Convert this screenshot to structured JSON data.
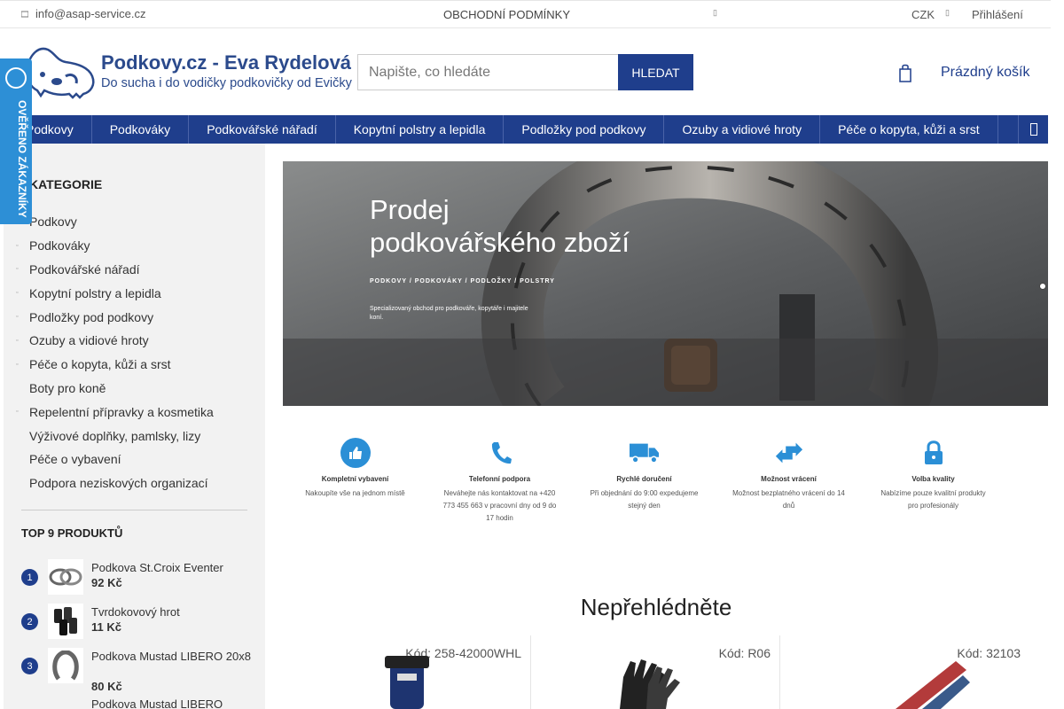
{
  "topbar": {
    "email": "info@asap-service.cz",
    "terms": "OBCHODNÍ PODMÍNKY",
    "currency": "CZK",
    "login": "Přihlášení"
  },
  "header": {
    "brand": "Podkovy.cz - Eva Rydelová",
    "tagline": "Do sucha i do vodičky podkovičky od Evičky",
    "search_placeholder": "Napište, co hledáte",
    "search_button": "HLEDAT",
    "cart_label": "Prázdný košík"
  },
  "badge": {
    "text": "OVĚŘENO ZÁKAZNÍKY"
  },
  "nav": [
    "Podkovy",
    "Podkováky",
    "Podkovářské nářadí",
    "Kopytní polstry a lepidla",
    "Podložky pod podkovy",
    "Ozuby a vidiové hroty",
    "Péče o kopyta, kůži a srst"
  ],
  "sidebar": {
    "title": "KATEGORIE",
    "categories": [
      {
        "label": "Podkovy",
        "bullet": true
      },
      {
        "label": "Podkováky",
        "bullet": true
      },
      {
        "label": "Podkovářské nářadí",
        "bullet": true
      },
      {
        "label": "Kopytní polstry a lepidla",
        "bullet": true
      },
      {
        "label": "Podložky pod podkovy",
        "bullet": true
      },
      {
        "label": "Ozuby a vidiové hroty",
        "bullet": true
      },
      {
        "label": "Péče o kopyta, kůži a srst",
        "bullet": true
      },
      {
        "label": "Boty pro koně",
        "bullet": false
      },
      {
        "label": "Repelentní přípravky a kosmetika",
        "bullet": true
      },
      {
        "label": "Výživové doplňky, pamlsky, lizy",
        "bullet": false
      },
      {
        "label": "Péče o vybavení",
        "bullet": false
      },
      {
        "label": "Podpora neziskových organizací",
        "bullet": false
      }
    ],
    "top_title": "TOP 9 PRODUKTŮ",
    "top_products": [
      {
        "rank": "1",
        "name": "Podkova St.Croix Eventer",
        "price": "92 Kč"
      },
      {
        "rank": "2",
        "name": "Tvrdokovový hrot",
        "price": "11 Kč"
      },
      {
        "rank": "3",
        "name": "Podkova Mustad LIBERO 20x8",
        "price": "80 Kč"
      },
      {
        "rank": "",
        "name": "Podkova Mustad LIBERO",
        "price": ""
      }
    ]
  },
  "banner": {
    "headline_1": "Prodej",
    "headline_2": "podkovářského zboží",
    "subline": "PODKOVY / PODKOVÁKY / PODLOŽKY / POLSTRY",
    "desc": "Specializovaný obchod pro podkováře, kopytáře i majitele koní."
  },
  "features": [
    {
      "title": "Kompletní vybavení",
      "desc": "Nakoupíte vše na jednom místě",
      "color": "#2b8fd6",
      "icon": "thumbs-up-icon"
    },
    {
      "title": "Telefonní podpora",
      "desc": "Neváhejte nás kontaktovat na +420 773 455 663 v pracovní dny od 9 do 17 hodin",
      "color": "#2b8fd6",
      "icon": "phone-icon"
    },
    {
      "title": "Rychlé doručení",
      "desc": "Při objednání do 9:00 expedujeme stejný den",
      "color": "#2b8fd6",
      "icon": "truck-icon"
    },
    {
      "title": "Možnost vrácení",
      "desc": "Možnost bezplatného vrácení do 14 dnů",
      "color": "#2b8fd6",
      "icon": "exchange-icon"
    },
    {
      "title": "Volba kvality",
      "desc": "Nabízíme pouze kvalitní produkty pro profesionály",
      "color": "#2b8fd6",
      "icon": "lock-icon"
    }
  ],
  "section_title": "Nepřehlédněte",
  "products": [
    {
      "code": "Kód: 258-42000WHL"
    },
    {
      "code": "Kód: R06"
    },
    {
      "code": "Kód: 32103"
    }
  ]
}
